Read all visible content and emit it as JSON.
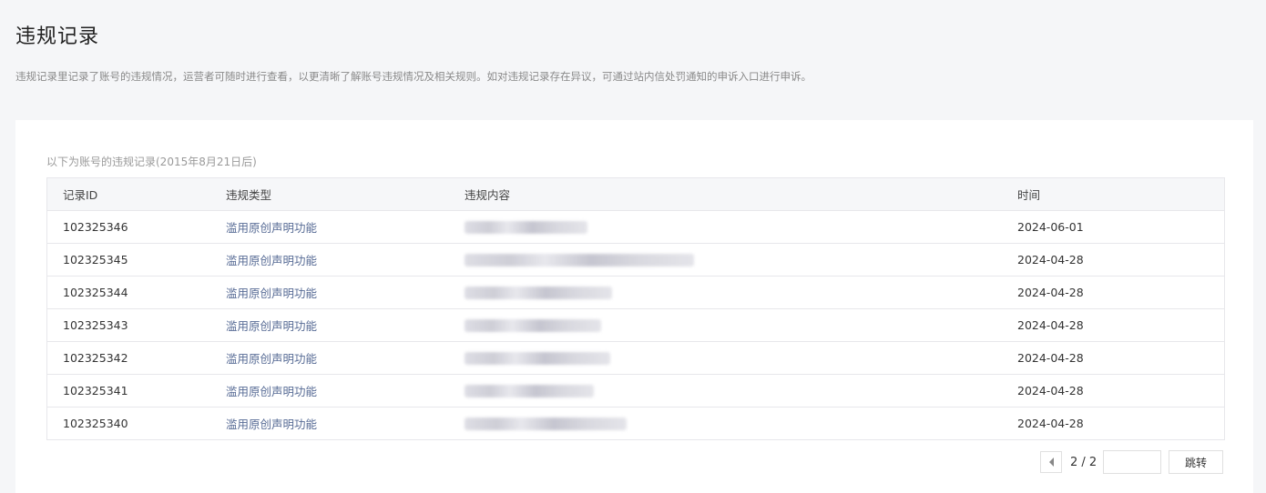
{
  "page": {
    "title": "违规记录",
    "description": "违规记录里记录了账号的违规情况，运营者可随时进行查看，以更清晰了解账号违规情况及相关规则。如对违规记录存在异议，可通过站内信处罚通知的申诉入口进行申诉。"
  },
  "records": {
    "caption": "以下为账号的违规记录(2015年8月21日后)",
    "columns": {
      "id": "记录ID",
      "type": "违规类型",
      "content": "违规内容",
      "time": "时间"
    },
    "rows": [
      {
        "id": "102325346",
        "type": "滥用原创声明功能",
        "content": "",
        "time": "2024-06-01"
      },
      {
        "id": "102325345",
        "type": "滥用原创声明功能",
        "content": "",
        "time": "2024-04-28"
      },
      {
        "id": "102325344",
        "type": "滥用原创声明功能",
        "content": "",
        "time": "2024-04-28"
      },
      {
        "id": "102325343",
        "type": "滥用原创声明功能",
        "content": "",
        "time": "2024-04-28"
      },
      {
        "id": "102325342",
        "type": "滥用原创声明功能",
        "content": "",
        "time": "2024-04-28"
      },
      {
        "id": "102325341",
        "type": "滥用原创声明功能",
        "content": "",
        "time": "2024-04-28"
      },
      {
        "id": "102325340",
        "type": "滥用原创声明功能",
        "content": "",
        "time": "2024-04-28"
      }
    ]
  },
  "pagination": {
    "prev_icon": "triangle-left-icon",
    "page_indicator": "2 / 2",
    "jump_input_value": "",
    "jump_label": "跳转"
  },
  "colors": {
    "background": "#f5f6f8",
    "panel": "#ffffff",
    "type_link": "#576b95",
    "header_bg": "#f6f7f9"
  }
}
